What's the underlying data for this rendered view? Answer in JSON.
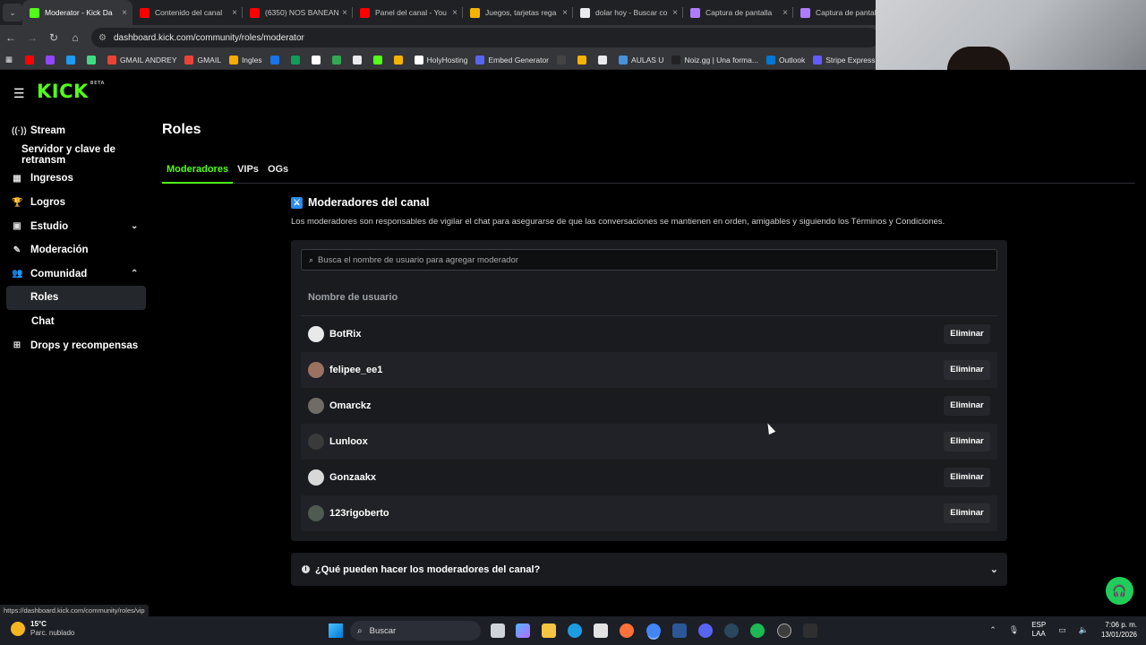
{
  "browser": {
    "tabs": [
      {
        "title": "Moderator - Kick Da",
        "color": "#53fc18",
        "active": true
      },
      {
        "title": "Contenido del canal",
        "color": "#ff0000"
      },
      {
        "title": "(6350) NOS BANEAN",
        "color": "#ff0000"
      },
      {
        "title": "Panel del canal - You",
        "color": "#ff0000"
      },
      {
        "title": "Juegos, tarjetas rega",
        "color": "#f4b400"
      },
      {
        "title": "dolar hoy - Buscar co",
        "color": "#e8eaed"
      },
      {
        "title": "Captura de pantalla",
        "color": "#b07cff"
      },
      {
        "title": "Captura de pantalla",
        "color": "#b07cff"
      }
    ],
    "url": "dashboard.kick.com/community/roles/moderator",
    "bookmarks": [
      {
        "label": "",
        "color": "#ff0000"
      },
      {
        "label": "",
        "color": "#9146ff"
      },
      {
        "label": "",
        "color": "#1d9bf0"
      },
      {
        "label": "",
        "color": "#3ddc84"
      },
      {
        "label": "GMAIL ANDREY",
        "color": "#ea4335"
      },
      {
        "label": "GMAIL",
        "color": "#ea4335"
      },
      {
        "label": "Ingles",
        "color": "#f9ab00"
      },
      {
        "label": "",
        "color": "#1a73e8"
      },
      {
        "label": "",
        "color": "#0f9d58"
      },
      {
        "label": "",
        "color": "#ffffff"
      },
      {
        "label": "",
        "color": "#34a853"
      },
      {
        "label": "",
        "color": "#e8eaed"
      },
      {
        "label": "",
        "color": "#53fc18"
      },
      {
        "label": "",
        "color": "#f4b400"
      },
      {
        "label": "HolyHosting",
        "color": "#ffffff"
      },
      {
        "label": "Embed Generator",
        "color": "#5865f2"
      },
      {
        "label": "",
        "color": "#444444"
      },
      {
        "label": "",
        "color": "#f4b400"
      },
      {
        "label": "",
        "color": "#e8eaed"
      },
      {
        "label": "AULAS U",
        "color": "#4a90d9"
      },
      {
        "label": "Noiz.gg | Una forma...",
        "color": "#222222"
      },
      {
        "label": "Outlook",
        "color": "#0078d4"
      },
      {
        "label": "Stripe Express",
        "color": "#635bff"
      },
      {
        "label": "",
        "color": "#ffffff"
      }
    ]
  },
  "app": {
    "logo": "KICK",
    "logo_badge": "BETA",
    "sidebar": [
      {
        "label": "Stream",
        "icon": "broadcast-icon",
        "glyph": "((·))",
        "kind": "top"
      },
      {
        "label": "Servidor y clave de retransm",
        "icon": "",
        "glyph": "",
        "kind": "sub"
      },
      {
        "label": "Ingresos",
        "icon": "chart-icon",
        "glyph": "▦",
        "kind": "top"
      },
      {
        "label": "Logros",
        "icon": "trophy-icon",
        "glyph": "🏆",
        "kind": "top"
      },
      {
        "label": "Estudio",
        "icon": "studio-icon",
        "glyph": "▣",
        "kind": "top",
        "chevron": "down"
      },
      {
        "label": "Moderación",
        "icon": "wrench-icon",
        "glyph": "✎",
        "kind": "top"
      },
      {
        "label": "Comunidad",
        "icon": "people-icon",
        "glyph": "👥",
        "kind": "top",
        "chevron": "up"
      },
      {
        "label": "Roles",
        "icon": "",
        "glyph": "",
        "kind": "active"
      },
      {
        "label": "Chat",
        "icon": "",
        "glyph": "",
        "kind": "sub2"
      },
      {
        "label": "Drops y recompensas",
        "icon": "gift-icon",
        "glyph": "⊞",
        "kind": "top"
      }
    ],
    "page_title": "Roles",
    "role_tabs": [
      "Moderadores",
      "VIPs",
      "OGs"
    ],
    "section_title": "Moderadores del canal",
    "section_description": "Los moderadores son responsables de vigilar el chat para asegurarse de que las conversaciones se mantienen en orden, amigables y siguiendo los Términos y Condiciones.",
    "search_placeholder": "Busca el nombre de usuario para agregar moderador",
    "column_header": "Nombre de usuario",
    "remove_label": "Eliminar",
    "moderators": [
      {
        "username": "BotRix",
        "avatar_color": "#e9e9e9"
      },
      {
        "username": "felipee_ee1",
        "avatar_color": "#9b7260"
      },
      {
        "username": "Omarckz",
        "avatar_color": "#6f6c68"
      },
      {
        "username": "Lunloox",
        "avatar_color": "#3a3a3a"
      },
      {
        "username": "Gonzaakx",
        "avatar_color": "#d8d8d8"
      },
      {
        "username": "123rigoberto",
        "avatar_color": "#4f5a52"
      }
    ],
    "faq_title": "¿Qué pueden hacer los moderadores del canal?",
    "accent_color": "#53fc18"
  },
  "status_url": "https://dashboard.kick.com/community/roles/vip",
  "taskbar": {
    "temperature": "15°C",
    "weather": "Parc. nublado",
    "search_label": "Buscar",
    "language": "ESP",
    "language_sub": "LAA",
    "time": "7:06 p. m.",
    "date": "13/01/2026"
  }
}
